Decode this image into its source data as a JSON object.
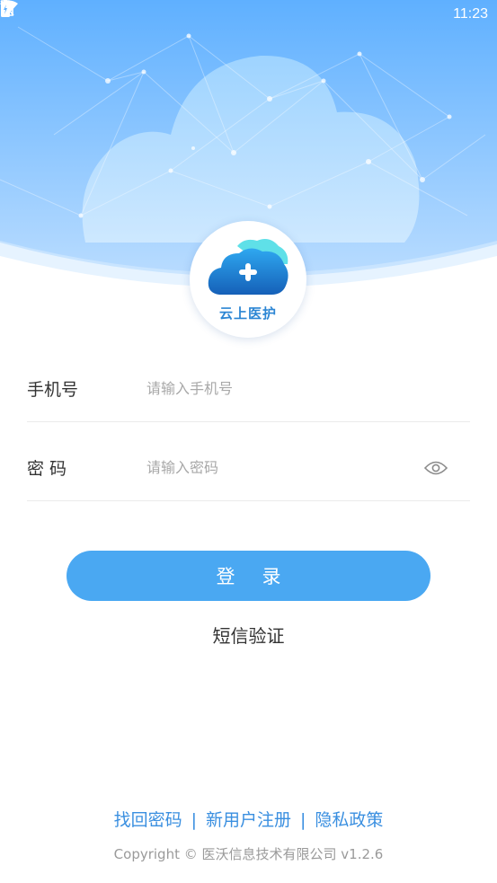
{
  "status_bar": {
    "time": "11:23",
    "icons": [
      "wifi-icon",
      "no-sim-icon",
      "battery-charging-icon"
    ]
  },
  "logo": {
    "icon": "cloud-plus-icon",
    "text": "云上医护"
  },
  "form": {
    "phone_label": "手机号",
    "phone_placeholder": "请输入手机号",
    "phone_value": "",
    "password_label": "密 码",
    "password_placeholder": "请输入密码",
    "password_value": "",
    "toggle_icon": "eye-icon"
  },
  "login_button": "登录",
  "sms_link": "短信验证",
  "footer": {
    "find_password": "找回密码",
    "separator": "|",
    "register": "新用户注册",
    "privacy": "隐私政策",
    "copyright": "Copyright © 医沃信息技术有限公司 v1.2.6"
  },
  "colors": {
    "accent": "#4aa8f2",
    "header_top": "#6fb6ff",
    "header_bottom": "#bfe0ff",
    "link": "#3a8fe0"
  }
}
